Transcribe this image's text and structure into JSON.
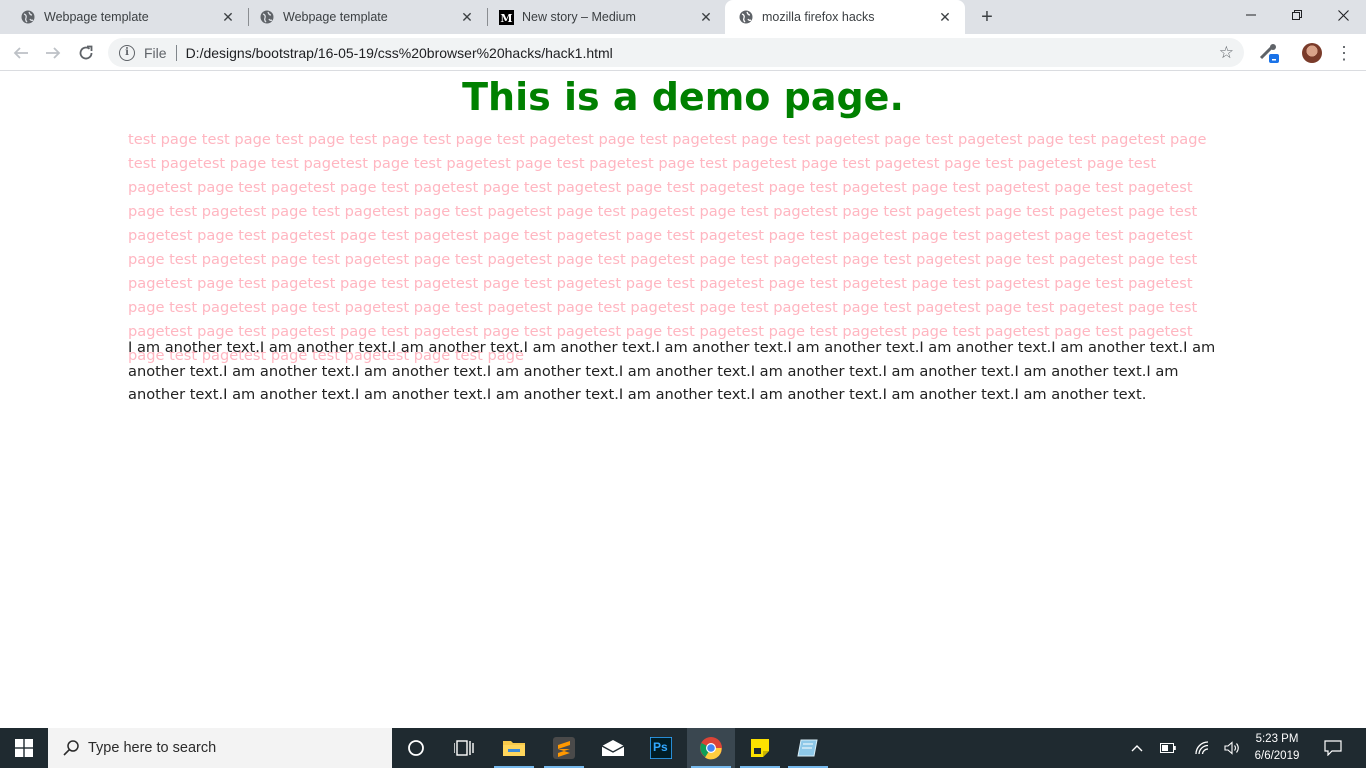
{
  "browser": {
    "tabs": [
      {
        "title": "Webpage template",
        "favicon": "globe-icon",
        "active": false
      },
      {
        "title": "Webpage template",
        "favicon": "globe-icon",
        "active": false
      },
      {
        "title": "New story – Medium",
        "favicon": "medium-icon",
        "active": false
      },
      {
        "title": "mozilla firefox hacks",
        "favicon": "globe-icon",
        "active": true
      }
    ],
    "address_bar": {
      "scheme_label": "File",
      "url": "D:/designs/bootstrap/16-05-19/css%20browser%20hacks/hack1.html"
    }
  },
  "page": {
    "heading": "This is a demo page.",
    "pink_paragraph": "test page test page test page test page test page test pagetest page test pagetest page test pagetest page test pagetest page test pagetest page test pagetest page test pagetest page test pagetest page test pagetest page test pagetest page test pagetest page test pagetest page test pagetest page test pagetest page test pagetest page test pagetest page test pagetest page test pagetest page test pagetest page test pagetest page test pagetest page test pagetest page test pagetest page test pagetest page test pagetest page test pagetest page test pagetest page test pagetest page test pagetest page test pagetest page test pagetest page test pagetest page test pagetest page test pagetest page test pagetest page test pagetest page test pagetest page test pagetest page test pagetest page test pagetest page test pagetest page test pagetest page test pagetest page test pagetest page test pagetest page test pagetest page test pagetest page test pagetest page test pagetest page test pagetest page test pagetest page test pagetest page test pagetest page test pagetest page test pagetest page test pagetest page test pagetest page test pagetest page test pagetest page test pagetest page test pagetest page test pagetest page test pagetest page test pagetest page test pagetest page test pagetest page test pagetest page test page",
    "another_paragraph": "I am another text.I am another text.I am another text.I am another text.I am another text.I am another text.I am another text.I am another text.I am another text.I am another text.I am another text.I am another text.I am another text.I am another text.I am another text.I am another text.I am another text.I am another text.I am another text.I am another text.I am another text.I am another text.I am another text.I am another text.",
    "heading_color": "#008000",
    "pink_color": "#ffb6c1"
  },
  "taskbar": {
    "search_placeholder": "Type here to search",
    "apps": [
      "cortana-icon",
      "task-view-icon",
      "file-explorer-icon",
      "sublime-text-icon",
      "mail-icon",
      "photoshop-icon",
      "chrome-icon",
      "sticky-notes-icon",
      "app-icon"
    ],
    "photoshop_label": "Ps",
    "time": "5:23 PM",
    "date": "6/6/2019"
  }
}
